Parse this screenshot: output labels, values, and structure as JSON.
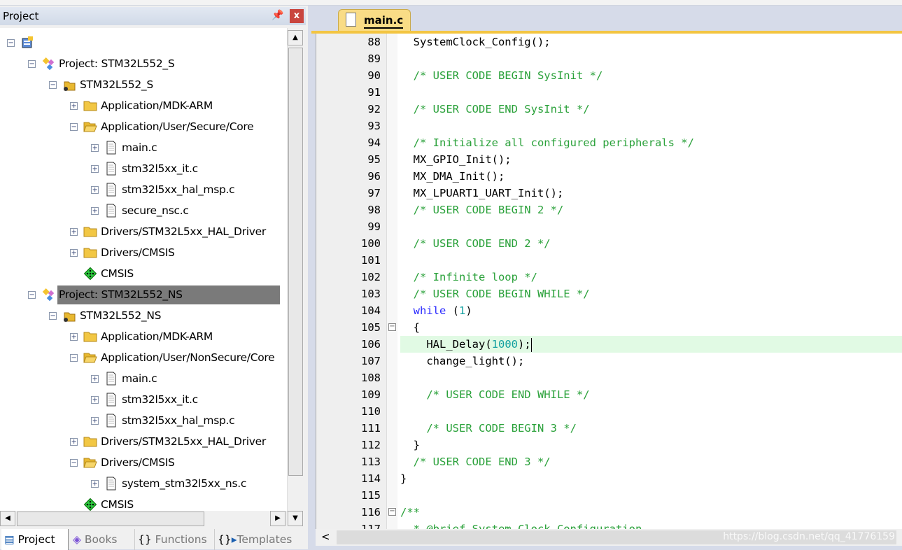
{
  "project_panel": {
    "title": "Project",
    "pin_icon": "pin-icon",
    "close_label": "x"
  },
  "tree": [
    {
      "level": 0,
      "exp": "-",
      "icon": "workspace",
      "label": ""
    },
    {
      "level": 1,
      "exp": "-",
      "icon": "project",
      "label": "Project: STM32L552_S"
    },
    {
      "level": 2,
      "exp": "-",
      "icon": "target",
      "label": "STM32L552_S"
    },
    {
      "level": 3,
      "exp": "+",
      "icon": "folder",
      "label": "Application/MDK-ARM"
    },
    {
      "level": 3,
      "exp": "-",
      "icon": "folder-open",
      "label": "Application/User/Secure/Core"
    },
    {
      "level": 4,
      "exp": "+",
      "icon": "file",
      "label": "main.c"
    },
    {
      "level": 4,
      "exp": "+",
      "icon": "file",
      "label": "stm32l5xx_it.c"
    },
    {
      "level": 4,
      "exp": "+",
      "icon": "file",
      "label": "stm32l5xx_hal_msp.c"
    },
    {
      "level": 4,
      "exp": "+",
      "icon": "file",
      "label": "secure_nsc.c"
    },
    {
      "level": 3,
      "exp": "+",
      "icon": "folder",
      "label": "Drivers/STM32L5xx_HAL_Driver"
    },
    {
      "level": 3,
      "exp": "+",
      "icon": "folder",
      "label": "Drivers/CMSIS"
    },
    {
      "level": 3,
      "exp": "",
      "icon": "component",
      "label": "CMSIS"
    },
    {
      "level": 1,
      "exp": "-",
      "icon": "project",
      "label": "Project: STM32L552_NS",
      "selected": true
    },
    {
      "level": 2,
      "exp": "-",
      "icon": "target",
      "label": "STM32L552_NS"
    },
    {
      "level": 3,
      "exp": "+",
      "icon": "folder",
      "label": "Application/MDK-ARM"
    },
    {
      "level": 3,
      "exp": "-",
      "icon": "folder-open",
      "label": "Application/User/NonSecure/Core"
    },
    {
      "level": 4,
      "exp": "+",
      "icon": "file",
      "label": "main.c"
    },
    {
      "level": 4,
      "exp": "+",
      "icon": "file",
      "label": "stm32l5xx_it.c"
    },
    {
      "level": 4,
      "exp": "+",
      "icon": "file",
      "label": "stm32l5xx_hal_msp.c"
    },
    {
      "level": 3,
      "exp": "+",
      "icon": "folder",
      "label": "Drivers/STM32L5xx_HAL_Driver"
    },
    {
      "level": 3,
      "exp": "-",
      "icon": "folder-open",
      "label": "Drivers/CMSIS"
    },
    {
      "level": 4,
      "exp": "+",
      "icon": "file",
      "label": "system_stm32l5xx_ns.c"
    },
    {
      "level": 3,
      "exp": "",
      "icon": "component",
      "label": "CMSIS"
    }
  ],
  "bottom_tabs": [
    {
      "label": "Project",
      "active": true
    },
    {
      "label": "Books"
    },
    {
      "label": "Functions"
    },
    {
      "label": "Templates"
    }
  ],
  "editor": {
    "tab": "main.c",
    "current_line": 106,
    "lines": [
      {
        "n": "88",
        "s": [
          [
            "  SystemClock_Config();",
            ""
          ]
        ]
      },
      {
        "n": "89",
        "s": []
      },
      {
        "n": "90",
        "s": [
          [
            "  /* USER CODE BEGIN SysInit */",
            "c"
          ]
        ]
      },
      {
        "n": "91",
        "s": []
      },
      {
        "n": "92",
        "s": [
          [
            "  /* USER CODE END SysInit */",
            "c"
          ]
        ]
      },
      {
        "n": "93",
        "s": []
      },
      {
        "n": "94",
        "s": [
          [
            "  /* Initialize all configured peripherals */",
            "c"
          ]
        ]
      },
      {
        "n": "95",
        "s": [
          [
            "  MX_GPIO_Init();",
            ""
          ]
        ]
      },
      {
        "n": "96",
        "s": [
          [
            "  MX_DMA_Init();",
            ""
          ]
        ]
      },
      {
        "n": "97",
        "s": [
          [
            "  MX_LPUART1_UART_Init();",
            ""
          ]
        ]
      },
      {
        "n": "98",
        "s": [
          [
            "  /* USER CODE BEGIN 2 */",
            "c"
          ]
        ]
      },
      {
        "n": "99",
        "s": []
      },
      {
        "n": "100",
        "s": [
          [
            "  /* USER CODE END 2 */",
            "c"
          ]
        ]
      },
      {
        "n": "101",
        "s": []
      },
      {
        "n": "102",
        "s": [
          [
            "  /* Infinite loop */",
            "c"
          ]
        ]
      },
      {
        "n": "103",
        "s": [
          [
            "  /* USER CODE BEGIN WHILE */",
            "c"
          ]
        ]
      },
      {
        "n": "104",
        "s": [
          [
            "  ",
            ""
          ],
          [
            "while",
            "k"
          ],
          [
            " (",
            ""
          ],
          [
            "1",
            "n"
          ],
          [
            ")",
            ""
          ]
        ]
      },
      {
        "n": "105",
        "s": [
          [
            "  {",
            ""
          ]
        ],
        "fold": "-"
      },
      {
        "n": "106",
        "s": [
          [
            "    HAL_Delay(",
            ""
          ],
          [
            "1000",
            "n"
          ],
          [
            ");",
            ""
          ]
        ]
      },
      {
        "n": "107",
        "s": [
          [
            "    change_light();",
            ""
          ]
        ]
      },
      {
        "n": "108",
        "s": []
      },
      {
        "n": "109",
        "s": [
          [
            "    /* USER CODE END WHILE */",
            "c"
          ]
        ]
      },
      {
        "n": "110",
        "s": []
      },
      {
        "n": "111",
        "s": [
          [
            "    /* USER CODE BEGIN 3 */",
            "c"
          ]
        ]
      },
      {
        "n": "112",
        "s": [
          [
            "  }",
            ""
          ]
        ]
      },
      {
        "n": "113",
        "s": [
          [
            "  /* USER CODE END 3 */",
            "c"
          ]
        ]
      },
      {
        "n": "114",
        "s": [
          [
            "}",
            ""
          ]
        ]
      },
      {
        "n": "115",
        "s": []
      },
      {
        "n": "116",
        "s": [
          [
            "/**",
            "c"
          ]
        ],
        "fold": "-"
      },
      {
        "n": "117",
        "s": [
          [
            "  * @brief System Clock Configuration",
            "c"
          ]
        ]
      }
    ]
  },
  "watermark": "https://blog.csdn.net/qq_41776159",
  "colors": {
    "comment": "#2aa13a",
    "keyword": "#2a2aff",
    "number": "#11a0a0",
    "tab": "#f9dc86",
    "current_line": "#e1fae4"
  }
}
